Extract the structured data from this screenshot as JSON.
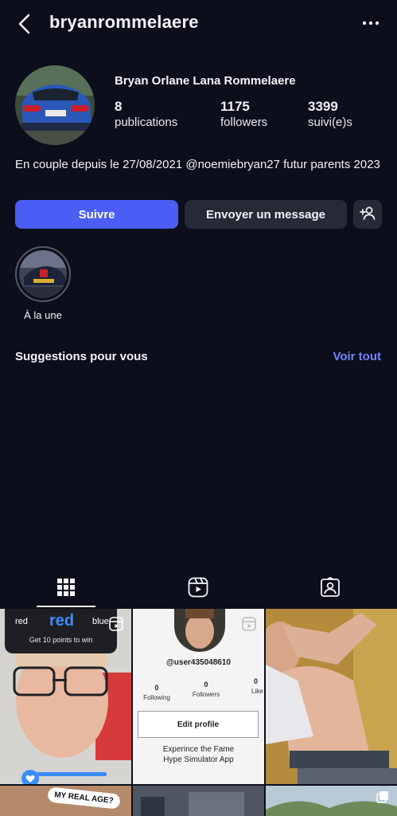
{
  "header": {
    "username": "bryanrommelaere",
    "back_icon": "back-arrow-icon",
    "menu_icon": "more-dots-icon"
  },
  "profile": {
    "full_name": "Bryan Orlane Lana Rommelaere",
    "stats": [
      {
        "value": "8",
        "label": "publications"
      },
      {
        "value": "1175",
        "label": "followers"
      },
      {
        "value": "3399",
        "label": "suivi(e)s"
      }
    ],
    "bio": "En couple depuis le 27/08/2021 @noemiebryan27 futur parents 2023"
  },
  "actions": {
    "follow_label": "Suivre",
    "message_label": "Envoyer un message",
    "add_icon": "add-person-icon"
  },
  "highlights": [
    {
      "label": "À la une"
    }
  ],
  "suggestions": {
    "title": "Suggestions pour vous",
    "see_all": "Voir tout"
  },
  "tabs": [
    {
      "icon": "grid-icon",
      "active": true
    },
    {
      "icon": "reels-icon",
      "active": false
    },
    {
      "icon": "tagged-icon",
      "active": false
    }
  ],
  "posts": {
    "post1": {
      "left_word": "red",
      "center_word": "red",
      "right_word": "blue",
      "caption": "Get 10 points to win"
    },
    "post2": {
      "handle": "@user435048610",
      "stats": [
        {
          "value": "0",
          "label": "Following"
        },
        {
          "value": "0",
          "label": "Followers"
        },
        {
          "value": "0",
          "label": "Like"
        }
      ],
      "button": "Edit profile",
      "footer_line1": "Experince the Fame",
      "footer_line2": "Hype Simulator App"
    },
    "post4": {
      "badge_text": "MY REAL AGE?"
    }
  },
  "colors": {
    "background": "#0c0f1b",
    "primary_button": "#4a5ef5",
    "secondary_button": "#262a36",
    "link": "#6f86ff"
  }
}
